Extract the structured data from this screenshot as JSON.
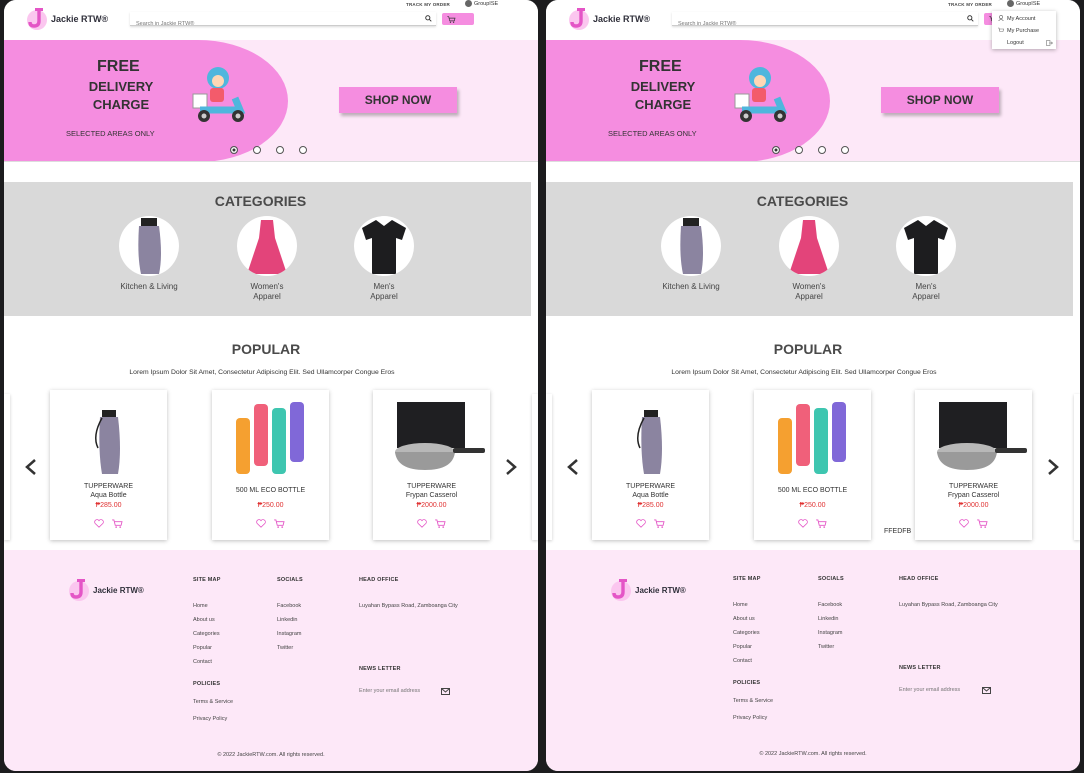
{
  "brand": "Jackie RTW®",
  "header": {
    "track_order": "TRACK MY ORDER",
    "username": "GroupISE",
    "search_placeholder": "Search in Jackie RTW®"
  },
  "account_menu": {
    "my_account": "My Account",
    "my_purchase": "My Purchase",
    "logout": "Logout"
  },
  "banner": {
    "line1": "FREE",
    "line2": "DELIVERY CHARGE",
    "note": "SELECTED AREAS ONLY",
    "cta": "SHOP NOW",
    "slide_count": 4,
    "active_slide": 1
  },
  "categories": {
    "title": "CATEGORIES",
    "items": [
      {
        "label": "Kitchen & Living"
      },
      {
        "label": "Women's Apparel"
      },
      {
        "label": "Men's Apparel"
      }
    ]
  },
  "popular": {
    "title": "POPULAR",
    "description": "Lorem Ipsum Dolor Sit Amet, Consectetur Adipiscing Elit. Sed Ullamcorper Congue Eros",
    "products": [
      {
        "line1": "TUPPERWARE",
        "line2": "Aqua Bottle",
        "price": "₱285.00"
      },
      {
        "line1": "500 ML ECO BOTTLE",
        "line2": "",
        "price": "₱250.00"
      },
      {
        "line1": "TUPPERWARE",
        "line2": "Frypan Casserol",
        "price": "₱2000.00"
      }
    ]
  },
  "footer": {
    "site_map": {
      "title": "SITE MAP",
      "links": [
        "Home",
        "About us",
        "Categories",
        "Popular",
        "Contact"
      ]
    },
    "socials": {
      "title": "SOCIALS",
      "links": [
        "Facebook",
        "Linkedin",
        "Instagram",
        "Twitter"
      ]
    },
    "head_office": {
      "title": "HEAD OFFICE",
      "address": "Luyahan Bypass Road, Zamboanga City"
    },
    "policies": {
      "title": "POLICIES",
      "links": [
        "Terms & Service",
        "Privacy Policy"
      ]
    },
    "newsletter": {
      "title": "NEWS LETTER",
      "placeholder": "Enter your email address"
    },
    "copyright": "© 2022 JackieRTW.com. All rights reserved."
  },
  "annotation": "FFEDFB",
  "colors": {
    "accent_pink": "#f58de0",
    "light_pink": "#fde8f8",
    "price_red": "#e03131",
    "category_bg": "#d9d9d9"
  }
}
